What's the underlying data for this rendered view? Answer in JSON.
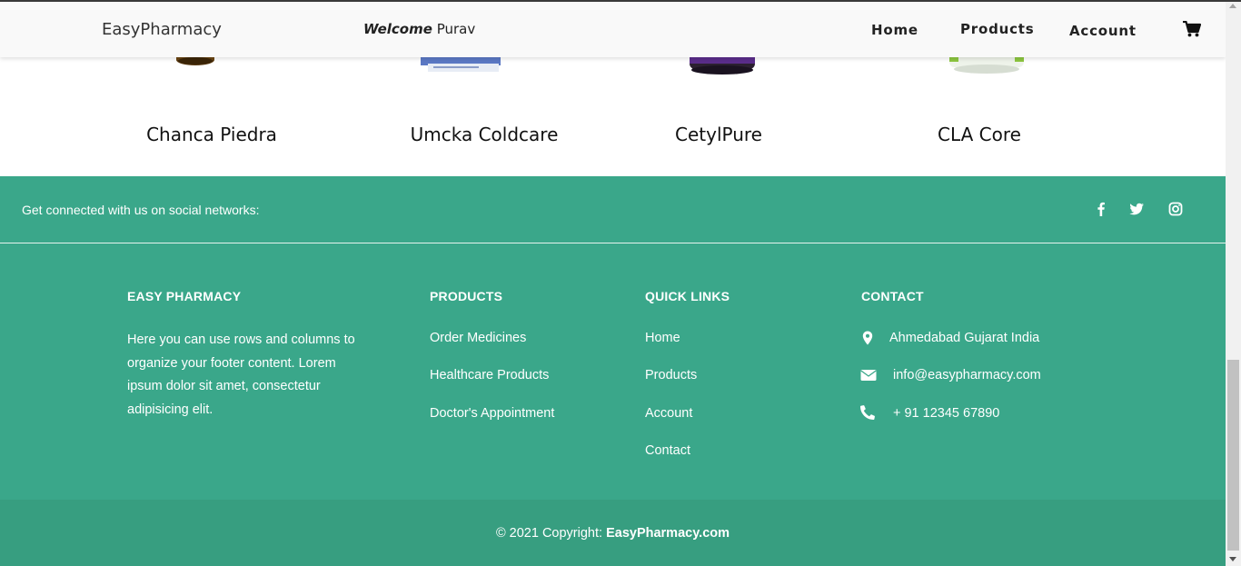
{
  "navbar": {
    "brand": "EasyPharmacy",
    "welcome_label": "Welcome",
    "welcome_user": "Purav",
    "links": [
      "Home",
      "Products",
      "Account"
    ],
    "cart_icon": "shopping-cart-icon"
  },
  "products": [
    {
      "name": "Chanca Piedra"
    },
    {
      "name": "Umcka Coldcare"
    },
    {
      "name": "CetylPure"
    },
    {
      "name": "CLA Core"
    }
  ],
  "social": {
    "text": "Get connected with us on social networks:",
    "icons": [
      "facebook-icon",
      "twitter-icon",
      "instagram-icon"
    ]
  },
  "footer": {
    "about": {
      "heading": "EASY PHARMACY",
      "text": "Here you can use rows and columns to organize your footer content. Lorem ipsum dolor sit amet, consectetur adipisicing elit."
    },
    "products": {
      "heading": "PRODUCTS",
      "links": [
        "Order Medicines",
        "Healthcare Products",
        "Doctor's Appointment"
      ]
    },
    "quick_links": {
      "heading": "QUICK LINKS",
      "links": [
        "Home",
        "Products",
        "Account",
        "Contact"
      ]
    },
    "contact": {
      "heading": "CONTACT",
      "address": "Ahmedabad Gujarat India",
      "email": "info@easypharmacy.com",
      "phone": "+ 91 12345 67890"
    }
  },
  "copyright": {
    "text": "© 2021 Copyright:",
    "site": "EasyPharmacy.com"
  },
  "colors": {
    "footer_green": "#3aa78a",
    "copyright_green": "#379e80"
  }
}
